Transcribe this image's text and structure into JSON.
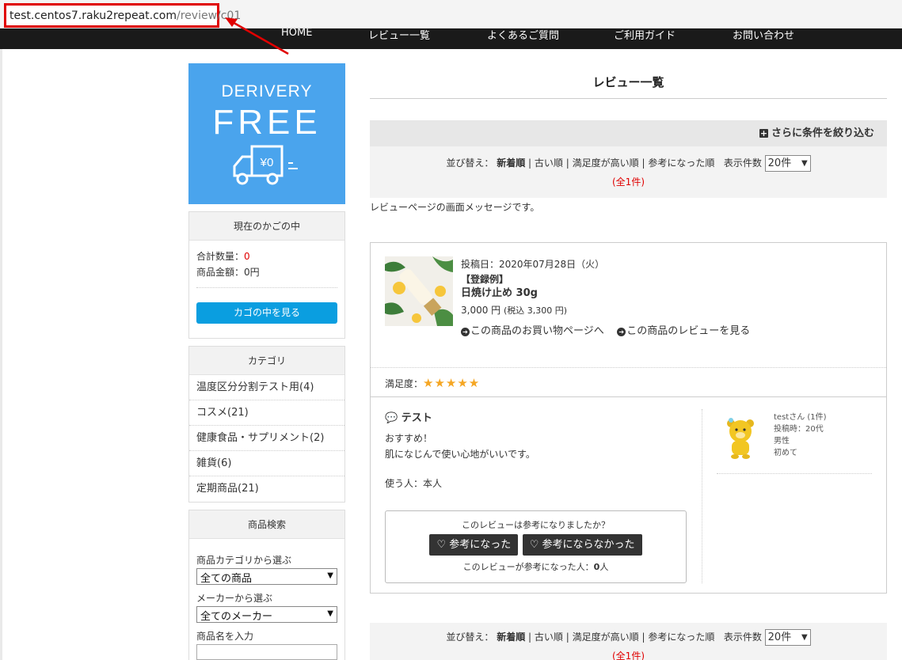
{
  "browser": {
    "url_host": "test.centos7.raku2repeat.com",
    "url_path": "/review/c01"
  },
  "nav": {
    "items": [
      "HOME",
      "レビュー一覧",
      "よくあるご質問",
      "ご利用ガイド",
      "お問い合わせ"
    ]
  },
  "colors": {
    "nav_bg": "#1a1a1a",
    "banner_bg": "#4aa4ed",
    "accent_button": "#0a9ee0",
    "highlight_red": "#e00000",
    "star": "#f5a623"
  },
  "sidebar": {
    "banner": {
      "line1": "DERIVERY",
      "line2": "FREE",
      "price_tag": "¥0"
    },
    "cart": {
      "heading": "現在のかごの中",
      "total_qty_label": "合計数量：",
      "total_qty_value": "0",
      "total_amount": "商品金額：0円",
      "view_button": "カゴの中を見る"
    },
    "category": {
      "heading": "カテゴリ",
      "items": [
        "温度区分分割テスト用(4)",
        "コスメ(21)",
        "健康食品・サプリメント(2)",
        "雑貨(6)",
        "定期商品(21)"
      ]
    },
    "search": {
      "heading": "商品検索",
      "category_label": "商品カテゴリから選ぶ",
      "category_value": "全ての商品",
      "maker_label": "メーカーから選ぶ",
      "maker_value": "全てのメーカー",
      "name_label": "商品名を入力"
    }
  },
  "main": {
    "title": "レビュー一覧",
    "filter_label": "さらに条件を絞り込む",
    "sort": {
      "label": "並び替え：",
      "options": [
        "新着順",
        "古い順",
        "満足度が高い順",
        "参考になった順"
      ],
      "separator": "|",
      "per_page_label": "表示件数",
      "per_page_value": "20件",
      "count": "(全1件)"
    },
    "message": "レビューページの画面メッセージです。",
    "review": {
      "posted": "投稿日：2020年07月28日（火）",
      "tag": "【登録例】",
      "product_name": "日焼け止め 30g",
      "price": "3,000 円",
      "price_tax": "(税込 3,300 円)",
      "link_shop": "この商品のお買い物ページへ",
      "link_reviews": "この商品のレビューを見る",
      "satisfaction_label": "満足度：",
      "stars": "★★★★★",
      "title": "テスト",
      "body_line1": "おすすめ！",
      "body_line2": "肌になじんで使い心地がいいです。",
      "user_line": "使う人：本人",
      "helpful_question": "このレビューは参考になりましたか？",
      "helpful_yes": "参考になった",
      "helpful_no": "参考にならなかった",
      "helpful_count_label": "このレビューが参考になった人：",
      "helpful_count_value": "0",
      "helpful_count_unit": "人",
      "reviewer": {
        "name": "testさん (1件)",
        "age": "投稿時：20代",
        "gender": "男性",
        "experience": "初めて"
      }
    }
  }
}
